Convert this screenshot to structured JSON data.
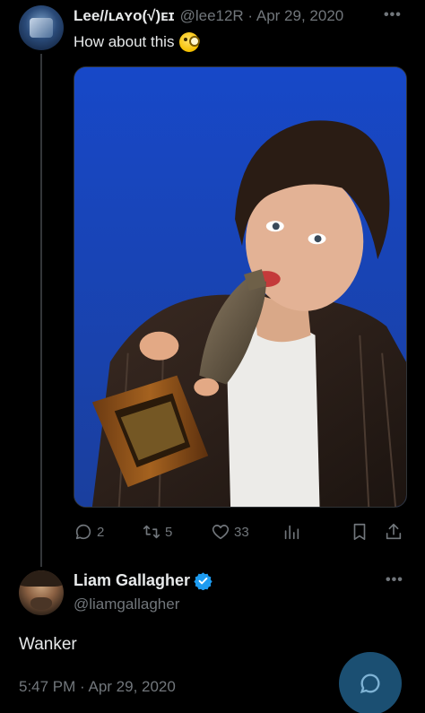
{
  "tweet1": {
    "name": "Lee//ʟᴀʏᴏ(√)ᴇɪ",
    "meta": "@lee12R · Apr 29, 2020",
    "text": "How about this",
    "emoji_icon": "face-with-monocle-emoji",
    "media_description_icon": "photo-man-with-trophy",
    "actions": {
      "reply_count": "2",
      "retweet_count": "5",
      "like_count": "33"
    }
  },
  "tweet2": {
    "name": "Liam Gallagher",
    "handle": "@liamgallagher",
    "text": "Wanker",
    "time": "5:47 PM · Apr 29, 2020"
  },
  "colors": {
    "background": "#000000",
    "text_primary": "#e7e9ea",
    "text_secondary": "#71767b",
    "verified": "#1d9bf0",
    "fab": "#1b4f72"
  }
}
